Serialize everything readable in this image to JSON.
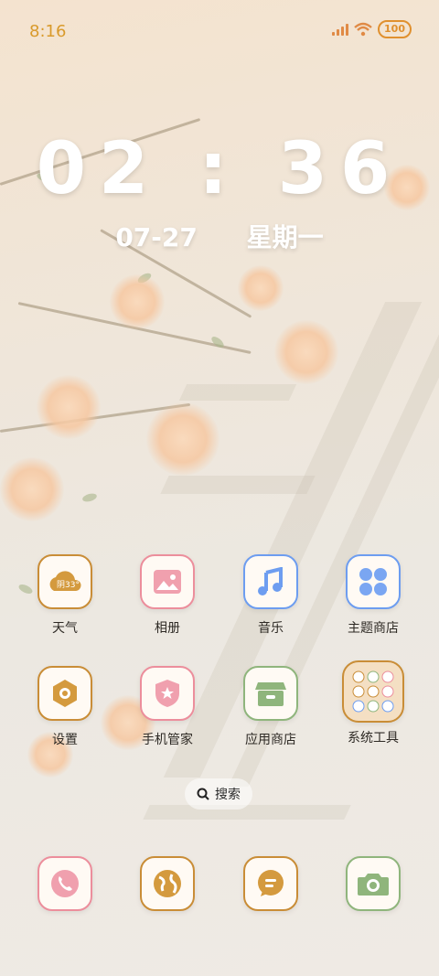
{
  "status_bar": {
    "time": "8:16",
    "battery": "100"
  },
  "clock": {
    "time": "02 : 36",
    "date": "07-27",
    "weekday": "星期一"
  },
  "weather_widget": {
    "condition": "阴",
    "temp": "33°"
  },
  "apps_row1": [
    {
      "label": "天气"
    },
    {
      "label": "相册"
    },
    {
      "label": "音乐"
    },
    {
      "label": "主题商店"
    }
  ],
  "apps_row2": [
    {
      "label": "设置"
    },
    {
      "label": "手机管家"
    },
    {
      "label": "应用商店"
    },
    {
      "label": "系统工具"
    }
  ],
  "search": {
    "label": "搜索"
  },
  "dock": [
    {
      "name": "phone"
    },
    {
      "name": "browser"
    },
    {
      "name": "messages"
    },
    {
      "name": "camera"
    }
  ],
  "colors": {
    "accent_brown": "#c98d37",
    "accent_pink": "#ec8e9c",
    "accent_blue": "#6d9df0",
    "accent_green": "#8fb57c"
  }
}
